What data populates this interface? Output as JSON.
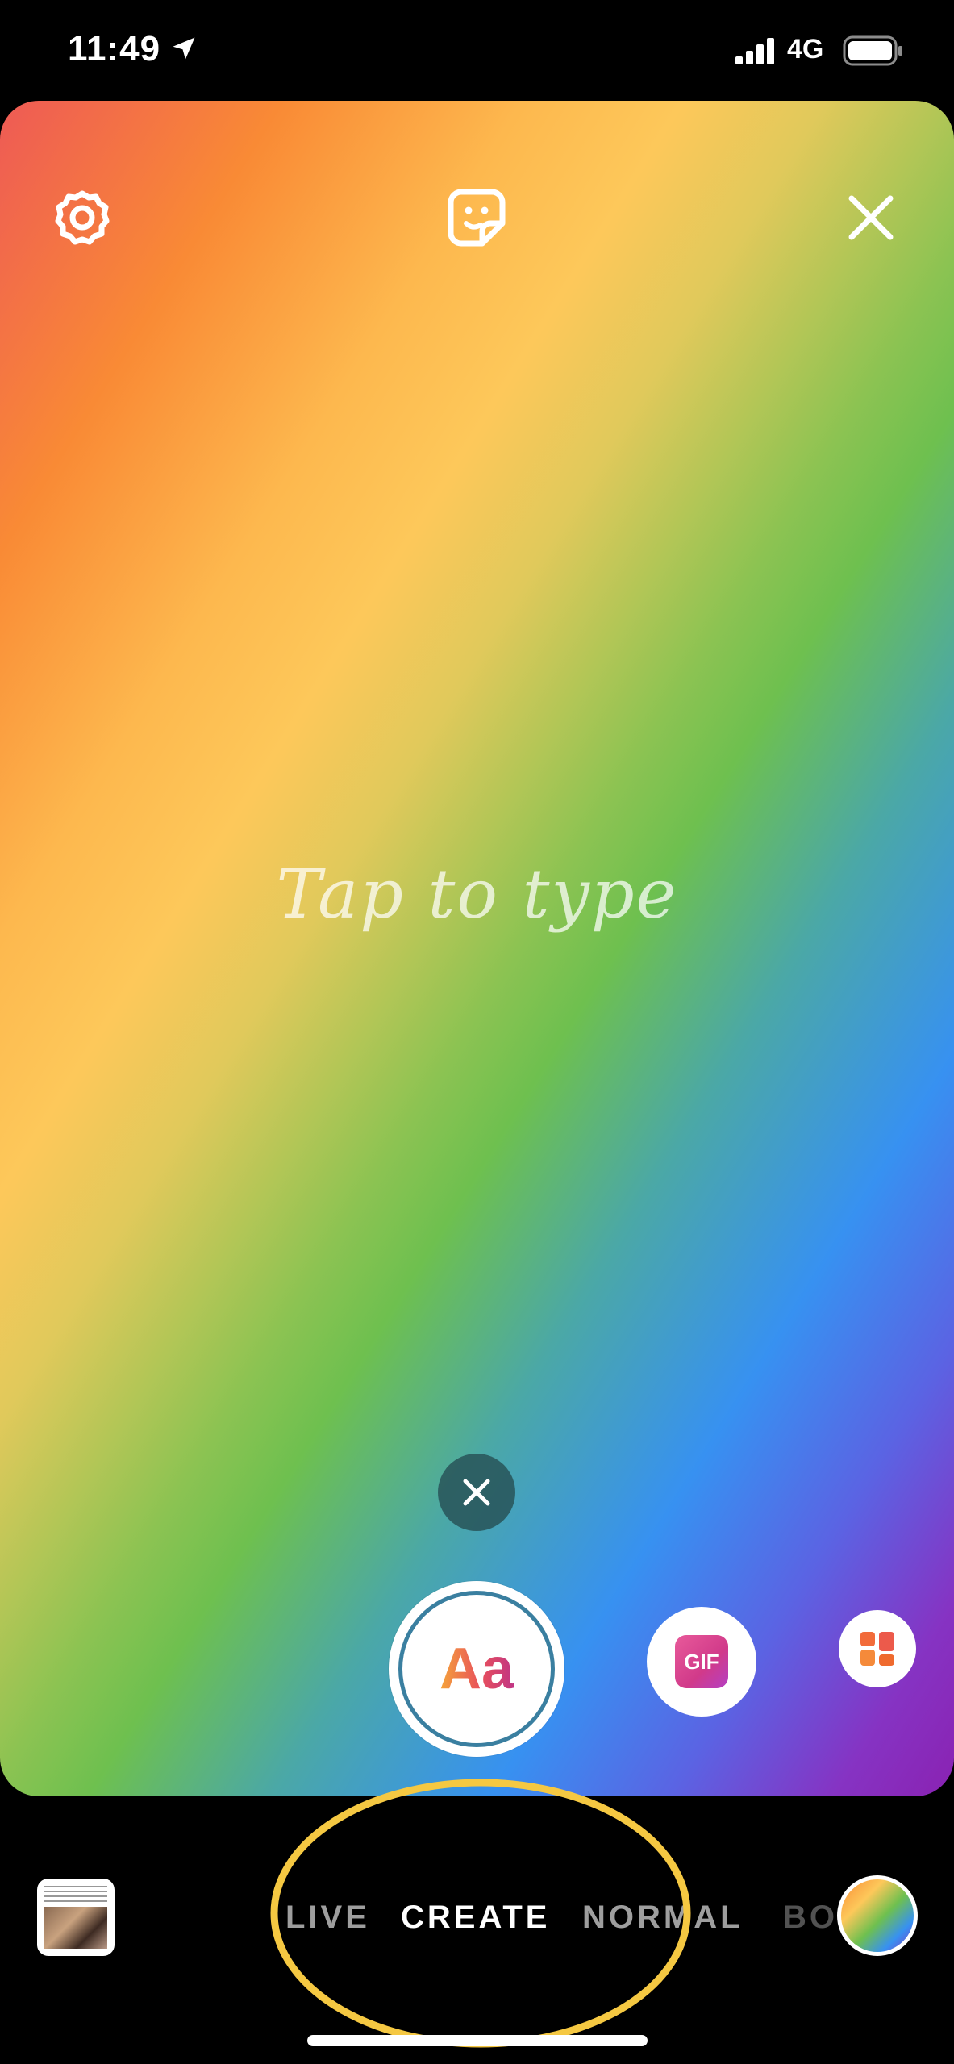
{
  "status_bar": {
    "time": "11:49",
    "network": "4G",
    "icons": [
      "location-arrow-icon",
      "cellular-signal-icon",
      "battery-icon"
    ]
  },
  "canvas": {
    "placeholder": "Tap to type",
    "top_icons": [
      "settings-icon",
      "sticker-icon",
      "close-icon"
    ],
    "gradient_colors": [
      "#ee5a55",
      "#f98a35",
      "#fdc85a",
      "#6ec04f",
      "#3791f1",
      "#8a22b2"
    ]
  },
  "tools": {
    "text_tool_label": "Aa",
    "gif_label": "GIF",
    "template_icon": "templates-icon",
    "dismiss_icon": "close-icon"
  },
  "mode_bar": {
    "modes": [
      "LIVE",
      "CREATE",
      "NORMAL",
      "BO"
    ],
    "active_mode": "CREATE",
    "highlight_color": "#f5c842"
  },
  "bottom": {
    "gallery_icon": "gallery-thumbnail",
    "color_picker_icon": "gradient-color-picker"
  }
}
